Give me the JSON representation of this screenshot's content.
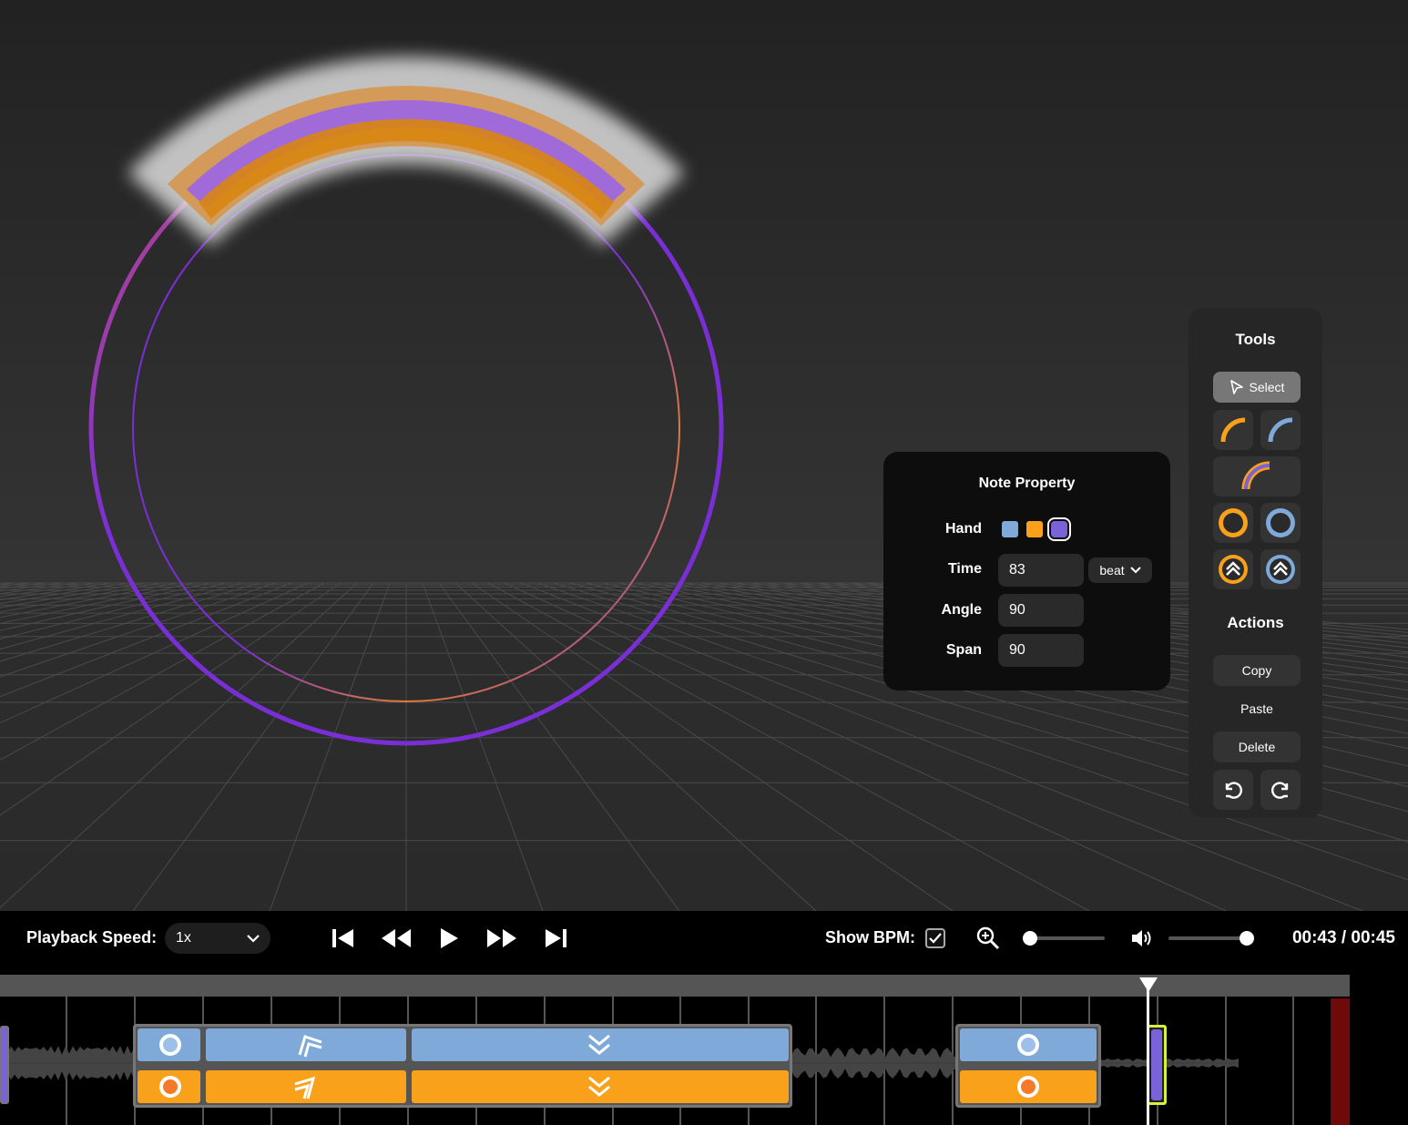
{
  "tools_panel": {
    "title": "Tools",
    "select_label": "Select",
    "tools": [
      "arc-orange-icon",
      "arc-blue-icon",
      "arc-dual-icon",
      "tap-orange-icon",
      "tap-blue-icon",
      "flick-orange-icon",
      "flick-blue-icon"
    ]
  },
  "actions_panel": {
    "title": "Actions",
    "copy_label": "Copy",
    "paste_label": "Paste",
    "delete_label": "Delete"
  },
  "note_property": {
    "title": "Note Property",
    "hand_label": "Hand",
    "hand_colors": [
      "#7fa9d9",
      "#f9a11b",
      "#7b62d9"
    ],
    "selected_hand": "#7b62d9",
    "time_label": "Time",
    "time_value": "83",
    "time_unit": "beat",
    "angle_label": "Angle",
    "angle_value": "90",
    "span_label": "Span",
    "span_value": "90"
  },
  "control_bar": {
    "playback_speed_label": "Playback Speed:",
    "playback_speed_value": "1x",
    "show_bpm_label": "Show BPM:",
    "show_bpm_checked": true,
    "zoom_level": 0,
    "volume_level": 1,
    "time_readout": "00:43 / 00:45"
  },
  "colors": {
    "left_hand": "#7fa9d9",
    "right_hand": "#f9a11b",
    "both_hands": "#7b62d9",
    "ring": "#7a2fd6"
  }
}
